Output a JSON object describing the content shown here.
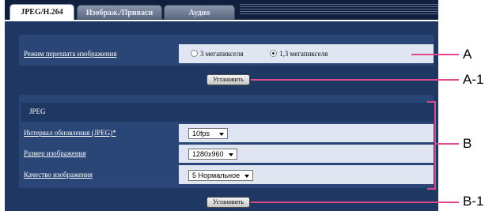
{
  "tabs": [
    {
      "label": "JPEG/H.264",
      "active": true
    },
    {
      "label": "Изображ./Приваси",
      "active": false
    },
    {
      "label": "Аудио",
      "active": false
    }
  ],
  "capture_mode": {
    "label": "Режим перехвата изображения",
    "options": [
      "3 мегапикселя",
      "1,3 мегапикселя"
    ],
    "selected": "1,3 мегапикселя",
    "set_button": "Установить"
  },
  "jpeg": {
    "header": "JPEG",
    "rows": [
      {
        "label": "Интервал обновления (JPEG)*",
        "value": "10fps"
      },
      {
        "label": "Размер изображения",
        "value": "1280x960"
      },
      {
        "label": "Качество изображения",
        "value": "5 Нормальное"
      }
    ],
    "set_button": "Установить"
  },
  "annotations": {
    "a": "A",
    "a1": "A-1",
    "b": "B",
    "b1": "B-1"
  },
  "colors": {
    "frame": "#1f3863",
    "callout": "#e1488d"
  }
}
